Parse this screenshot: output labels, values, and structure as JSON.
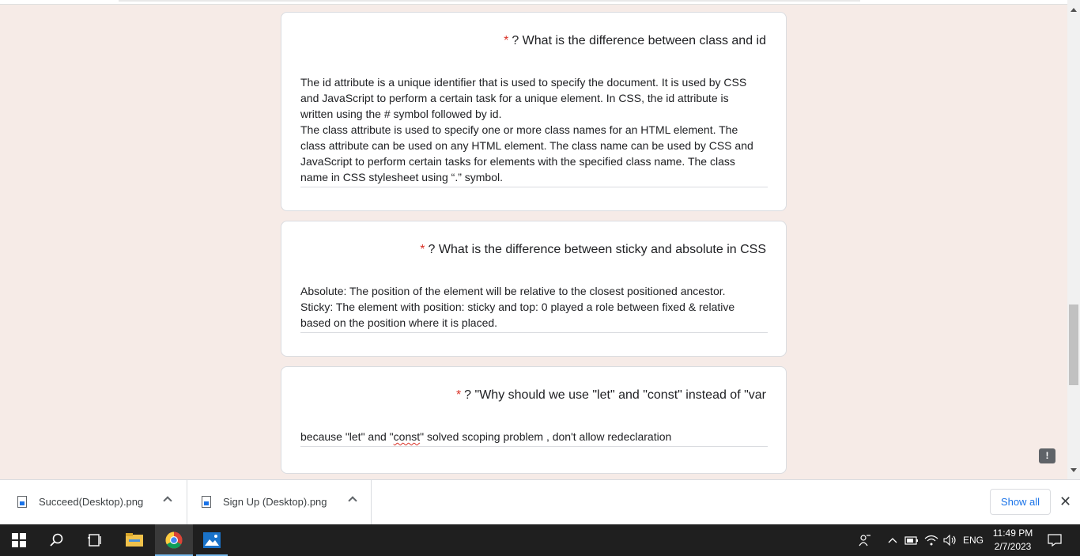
{
  "questions": [
    {
      "required_mark": "*",
      "title": "? What is the difference between class and id",
      "answer_lines": [
        "The id attribute is a unique identifier that is used to specify the document. It is used by CSS",
        "and JavaScript to perform a certain task for a unique element. In CSS, the id attribute is",
        "written using the # symbol followed by id.",
        "The class attribute is used to specify one or more class names for an HTML element. The",
        "class attribute can be used on any HTML element. The class name can be used by CSS and",
        "JavaScript to perform certain tasks for elements with the specified class name. The class",
        "name in CSS stylesheet using “.” symbol."
      ]
    },
    {
      "required_mark": "*",
      "title": "? What is the difference between sticky and absolute in CSS",
      "answer_lines": [
        "Absolute: The position of the element will be relative to the closest positioned ancestor.",
        "Sticky: The element with position: sticky and top: 0 played a role between fixed & relative",
        "based on the position where it is placed."
      ]
    },
    {
      "required_mark": "*",
      "title": "? \"Why should we use \"let\" and \"const\" instead of \"var",
      "answer_parts": {
        "before": "because \"let\" and \"",
        "misspelled": "const",
        "after": "\" solved scoping problem , don't allow redeclaration"
      }
    }
  ],
  "feedback_icon": "!",
  "downloads": {
    "items": [
      {
        "name": "Succeed(Desktop).png",
        "icon": "file-image-icon"
      },
      {
        "name": "Sign Up (Desktop).png",
        "icon": "file-image-icon"
      }
    ],
    "show_all_label": "Show all",
    "close_icon": "✕"
  },
  "taskbar": {
    "language": "ENG",
    "time": "11:49 PM",
    "date": "2/7/2023"
  },
  "colors": {
    "page_background": "#f6ebe7",
    "required_red": "#d93025",
    "link_blue": "#1a73e8",
    "taskbar": "#1f1f1f"
  }
}
